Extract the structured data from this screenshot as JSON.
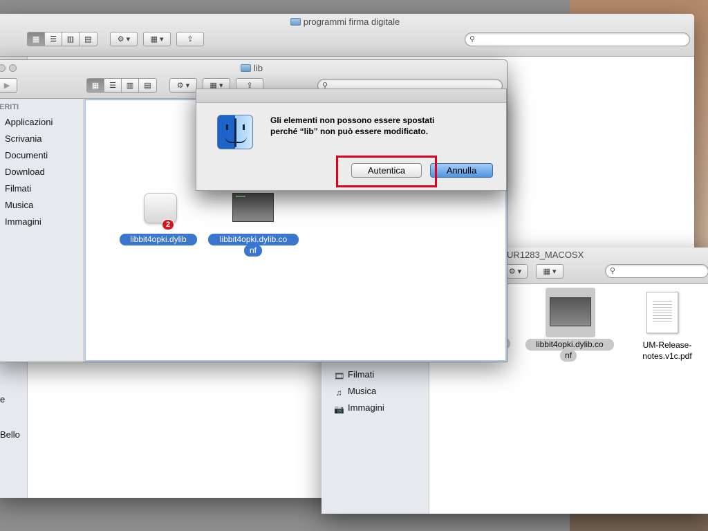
{
  "back_window": {
    "title": "programmi firma digitale",
    "sidebar_fragments": [
      "e",
      "Bello"
    ]
  },
  "lib_window": {
    "title": "lib",
    "sidebar_heading": "ERITI",
    "sidebar_items": [
      {
        "label": "Applicazioni"
      },
      {
        "label": "Scrivania"
      },
      {
        "label": "Documenti"
      },
      {
        "label": "Download"
      },
      {
        "label": "Filmati"
      },
      {
        "label": "Musica"
      },
      {
        "label": "Immagini"
      }
    ],
    "files": [
      {
        "name": "libbit4opki.dylib",
        "badge": "2"
      },
      {
        "name_line1": "libbit4opki.dylib.co",
        "name_line2": "nf"
      }
    ]
  },
  "right_window": {
    "title": "UR1283_MACOSX",
    "sidebar_items": [
      {
        "label": "Filmati",
        "icon": "film-icon"
      },
      {
        "label": "Musica",
        "icon": "music-icon"
      },
      {
        "label": "Immagini",
        "icon": "camera-icon"
      }
    ],
    "files": [
      {
        "name": "o"
      },
      {
        "name_line1": "libbit4opki.dylib.co",
        "name_line2": "nf"
      },
      {
        "name_line1": "UM-Release-",
        "name_line2": "notes.v1c.pdf"
      }
    ]
  },
  "dialog": {
    "message_line1": "Gli elementi non possono essere spostati",
    "message_line2": "perché “lib” non può essere modificato.",
    "authenticate_label": "Autentica",
    "cancel_label": "Annulla",
    "highlight_color": "#e0001b",
    "default_button_color": "#4f95e0"
  },
  "toolbar_glyphs": {
    "gear": "⚙ ▾",
    "arrange": "▦ ▾",
    "share": "⇪",
    "back": "▶",
    "search": "⚲"
  }
}
